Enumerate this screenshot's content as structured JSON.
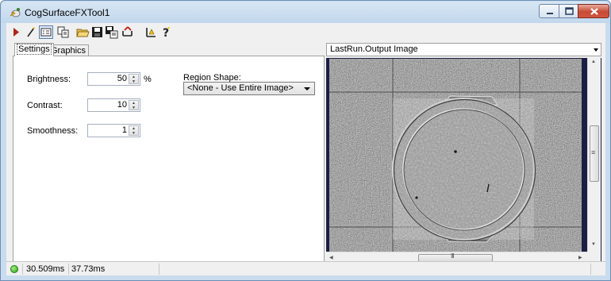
{
  "window": {
    "title": "CogSurfaceFXTool1",
    "controls": [
      "minimize",
      "maximize",
      "close"
    ]
  },
  "toolbar": {
    "icons": [
      "run-icon",
      "wand-icon",
      "image-display-icon",
      "copy-icon",
      "open-folder-icon",
      "save-icon",
      "save-as-icon",
      "reset-icon",
      "align-icon",
      "help-icon"
    ]
  },
  "tabs": [
    {
      "label": "Settings",
      "active": true
    },
    {
      "label": "Graphics",
      "active": false
    }
  ],
  "settings": {
    "brightness": {
      "label": "Brightness:",
      "value": "50",
      "unit": "%"
    },
    "contrast": {
      "label": "Contrast:",
      "value": "10"
    },
    "smoothness": {
      "label": "Smoothness:",
      "value": "1"
    },
    "region_shape": {
      "label": "Region Shape:",
      "value": "<None - Use Entire Image>"
    }
  },
  "image_view": {
    "selector": "LastRun.Output Image",
    "hscroll_center": "III",
    "vscroll_center": "≡"
  },
  "status": {
    "time1": "30.509ms",
    "time2": "37.73ms",
    "indicator_color": "#2fa11a"
  }
}
